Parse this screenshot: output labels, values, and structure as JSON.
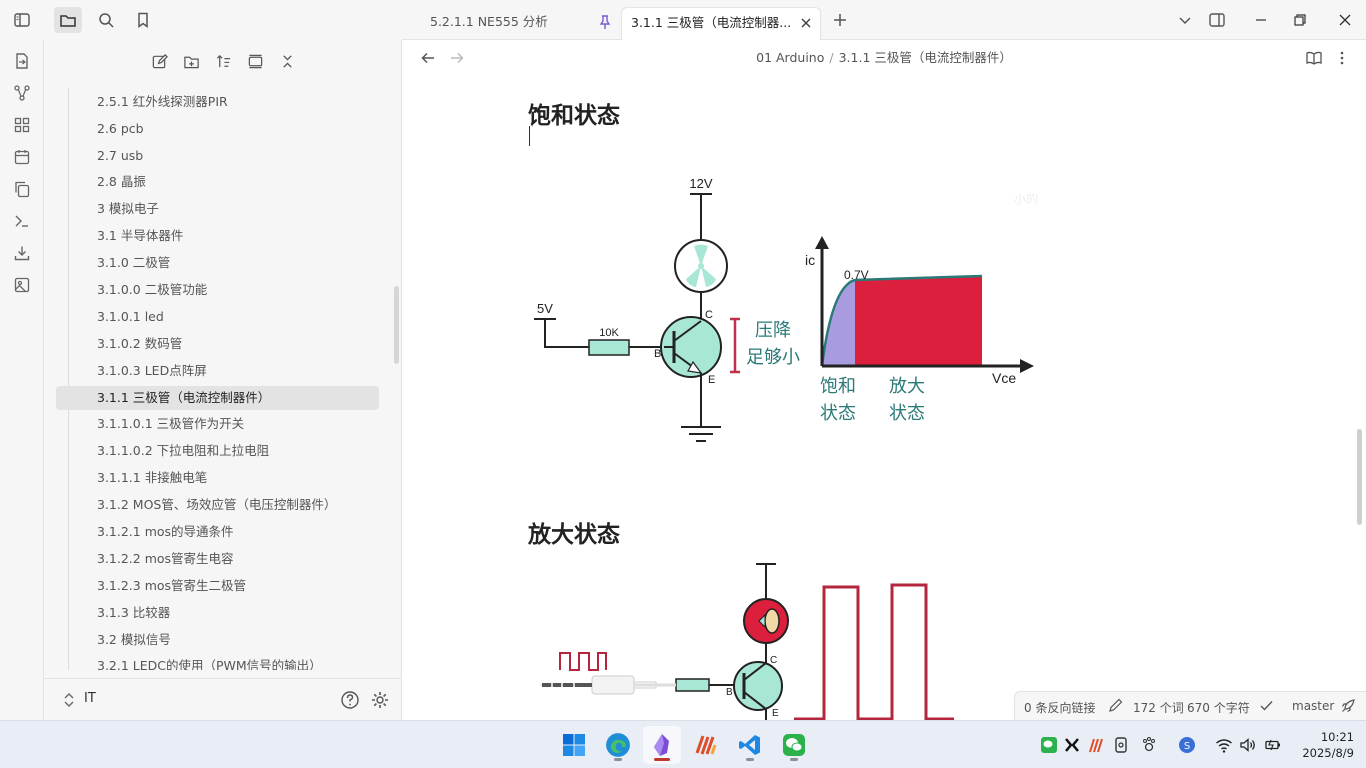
{
  "tabs": [
    {
      "label": "5.2.1.1 NE555 分析",
      "active": false,
      "pinned": true
    },
    {
      "label": "3.1.1 三极管（电流控制器...",
      "active": true
    }
  ],
  "breadcrumb": {
    "folder": "01 Arduino",
    "separator": "/",
    "file": "3.1.1 三极管（电流控制器件）"
  },
  "sidebar": {
    "vault_name": "IT",
    "items": [
      {
        "label": "2.5.1 红外线探测器PIR"
      },
      {
        "label": "2.6 pcb"
      },
      {
        "label": "2.7 usb"
      },
      {
        "label": "2.8 晶振"
      },
      {
        "label": "3 模拟电子"
      },
      {
        "label": "3.1 半导体器件"
      },
      {
        "label": "3.1.0 二极管"
      },
      {
        "label": "3.1.0.0 二极管功能"
      },
      {
        "label": "3.1.0.1 led"
      },
      {
        "label": "3.1.0.2 数码管"
      },
      {
        "label": "3.1.0.3 LED点阵屏"
      },
      {
        "label": "3.1.1 三极管（电流控制器件）",
        "active": true
      },
      {
        "label": "3.1.1.0.1 三极管作为开关"
      },
      {
        "label": "3.1.1.0.2 下拉电阻和上拉电阻"
      },
      {
        "label": "3.1.1.1 非接触电笔"
      },
      {
        "label": "3.1.2 MOS管、场效应管（电压控制器件）"
      },
      {
        "label": "3.1.2.1 mos的导通条件"
      },
      {
        "label": "3.1.2.2 mos管寄生电容"
      },
      {
        "label": "3.1.2.3 mos管寄生二极管"
      },
      {
        "label": "3.1.3 比较器"
      },
      {
        "label": "3.2 模拟信号"
      },
      {
        "label": "3.2.1 LEDC的使用（PWM信号的输出）"
      }
    ]
  },
  "content": {
    "heading1": "饱和状态",
    "heading2": "放大状态",
    "ghost_text": "小的"
  },
  "diagram1": {
    "supply": "12V",
    "input_voltage": "5V",
    "resistor": "10K",
    "pin_b": "B",
    "pin_c": "C",
    "pin_e": "E",
    "drop_label_1": "压降",
    "drop_label_2": "足够小",
    "graph_y": "ic",
    "graph_x": "Vce",
    "graph_knee": "0.7V",
    "region1_line1": "饱和",
    "region1_line2": "状态",
    "region2_line1": "放大",
    "region2_line2": "状态",
    "colors": {
      "teal": "#2a7a78",
      "fan": "#a8e6d6",
      "crimson": "#dc1f3c",
      "purple": "#a99be0",
      "resistor": "#a8e6d6",
      "bracket": "#c0304a"
    }
  },
  "diagram2": {
    "pin_b": "B",
    "pin_c": "C",
    "pin_e": "E"
  },
  "statusbar": {
    "backlinks": "0 条反向链接",
    "words": "172 个词",
    "chars": "670 个字符",
    "branch": "master"
  },
  "clock": {
    "time": "10:21",
    "date": "2025/8/9"
  }
}
